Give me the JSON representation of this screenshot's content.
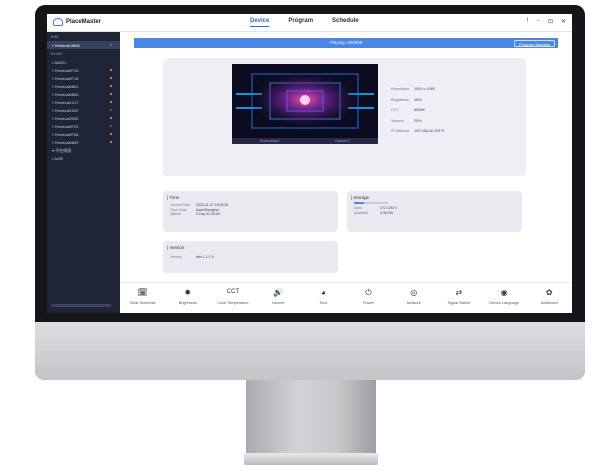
{
  "app": {
    "title": "PlaceMaster"
  },
  "nav": {
    "tabs": [
      "Device",
      "Program",
      "Schedule"
    ],
    "active": "Device"
  },
  "window_controls": [
    "!",
    "−",
    "⊡",
    "✕"
  ],
  "sidebar": {
    "head_all": "▾ All",
    "head_lan": "▾ LAN",
    "items": [
      {
        "label": "▪ Terminal 0808",
        "status": "red",
        "selected": true
      },
      {
        "label": "▪ AB021",
        "status": "on"
      },
      {
        "label": "▪ Terminal0715",
        "status": "on"
      },
      {
        "label": "▪ Terminal0716",
        "status": "on"
      },
      {
        "label": "▪ Terminal0801",
        "status": "on"
      },
      {
        "label": "▪ Terminal0806",
        "status": "on"
      },
      {
        "label": "▪ Terminal1217",
        "status": "on"
      },
      {
        "label": "▪ Terminal1002",
        "status": "off"
      },
      {
        "label": "▪ Terminal2035",
        "status": "on"
      },
      {
        "label": "▪ Terminal0703",
        "status": "off"
      },
      {
        "label": "▪ Terminal0706",
        "status": "on"
      },
      {
        "label": "▪ Terminal0809",
        "status": "on"
      },
      {
        "label": "▾ 不在线组",
        "status": "none"
      },
      {
        "label": "▪ AGB",
        "status": "none"
      }
    ]
  },
  "banner": {
    "text": "Playing: ab0808",
    "button": "Program Manage"
  },
  "preview": {
    "caption_left": "Screenshot1",
    "caption_right": "Capture 2"
  },
  "device_info": [
    {
      "key": "Resolution",
      "value": "1920 x 1080"
    },
    {
      "key": "Brightness",
      "value": "15%"
    },
    {
      "key": "CCT",
      "value": "6500K"
    },
    {
      "key": "Volume",
      "value": "20%"
    },
    {
      "key": "IP Address",
      "value": "192.168.42.119  ↻"
    }
  ],
  "cards": {
    "time": {
      "title": "| Time",
      "rows": [
        {
          "key": "Current Time",
          "value": "2022-11-07 18:33:26"
        },
        {
          "key": "Time Zone",
          "value": "Asia/Shanghai"
        },
        {
          "key": "Uptime",
          "value": "0 Day 01:33:25"
        }
      ]
    },
    "storage": {
      "title": "| Storage",
      "rows": [
        {
          "key": "Used",
          "value": "272.12M  ↻"
        },
        {
          "key": "Available",
          "value": "3.36 GB"
        }
      ]
    },
    "version": {
      "title": "| Version",
      "rows": [
        {
          "key": "Version",
          "value": "abc 1.1.1   ↻"
        }
      ]
    }
  },
  "toolbar": [
    {
      "icon": "calendar-icon",
      "glyph": "🗓",
      "label": "Clear Schedule"
    },
    {
      "icon": "brightness-icon",
      "glyph": "✹",
      "label": "Brightness"
    },
    {
      "icon": "cct-icon",
      "glyph": "CCT",
      "label": "Color Temperature"
    },
    {
      "icon": "volume-icon",
      "glyph": "🔊",
      "label": "Volume"
    },
    {
      "icon": "time-icon",
      "glyph": "◕",
      "label": "Time"
    },
    {
      "icon": "power-icon",
      "glyph": "⏻",
      "label": "Power"
    },
    {
      "icon": "network-icon",
      "glyph": "◎",
      "label": "Network"
    },
    {
      "icon": "signal-switch-icon",
      "glyph": "⇄",
      "label": "Signal Switch"
    },
    {
      "icon": "language-icon",
      "glyph": "◉",
      "label": "Device Language"
    },
    {
      "icon": "advanced-icon",
      "glyph": "✿",
      "label": "Advanced"
    }
  ],
  "colors": {
    "accent": "#2f63d6",
    "banner": "#4c86e3",
    "sidebar": "#1f2436"
  }
}
